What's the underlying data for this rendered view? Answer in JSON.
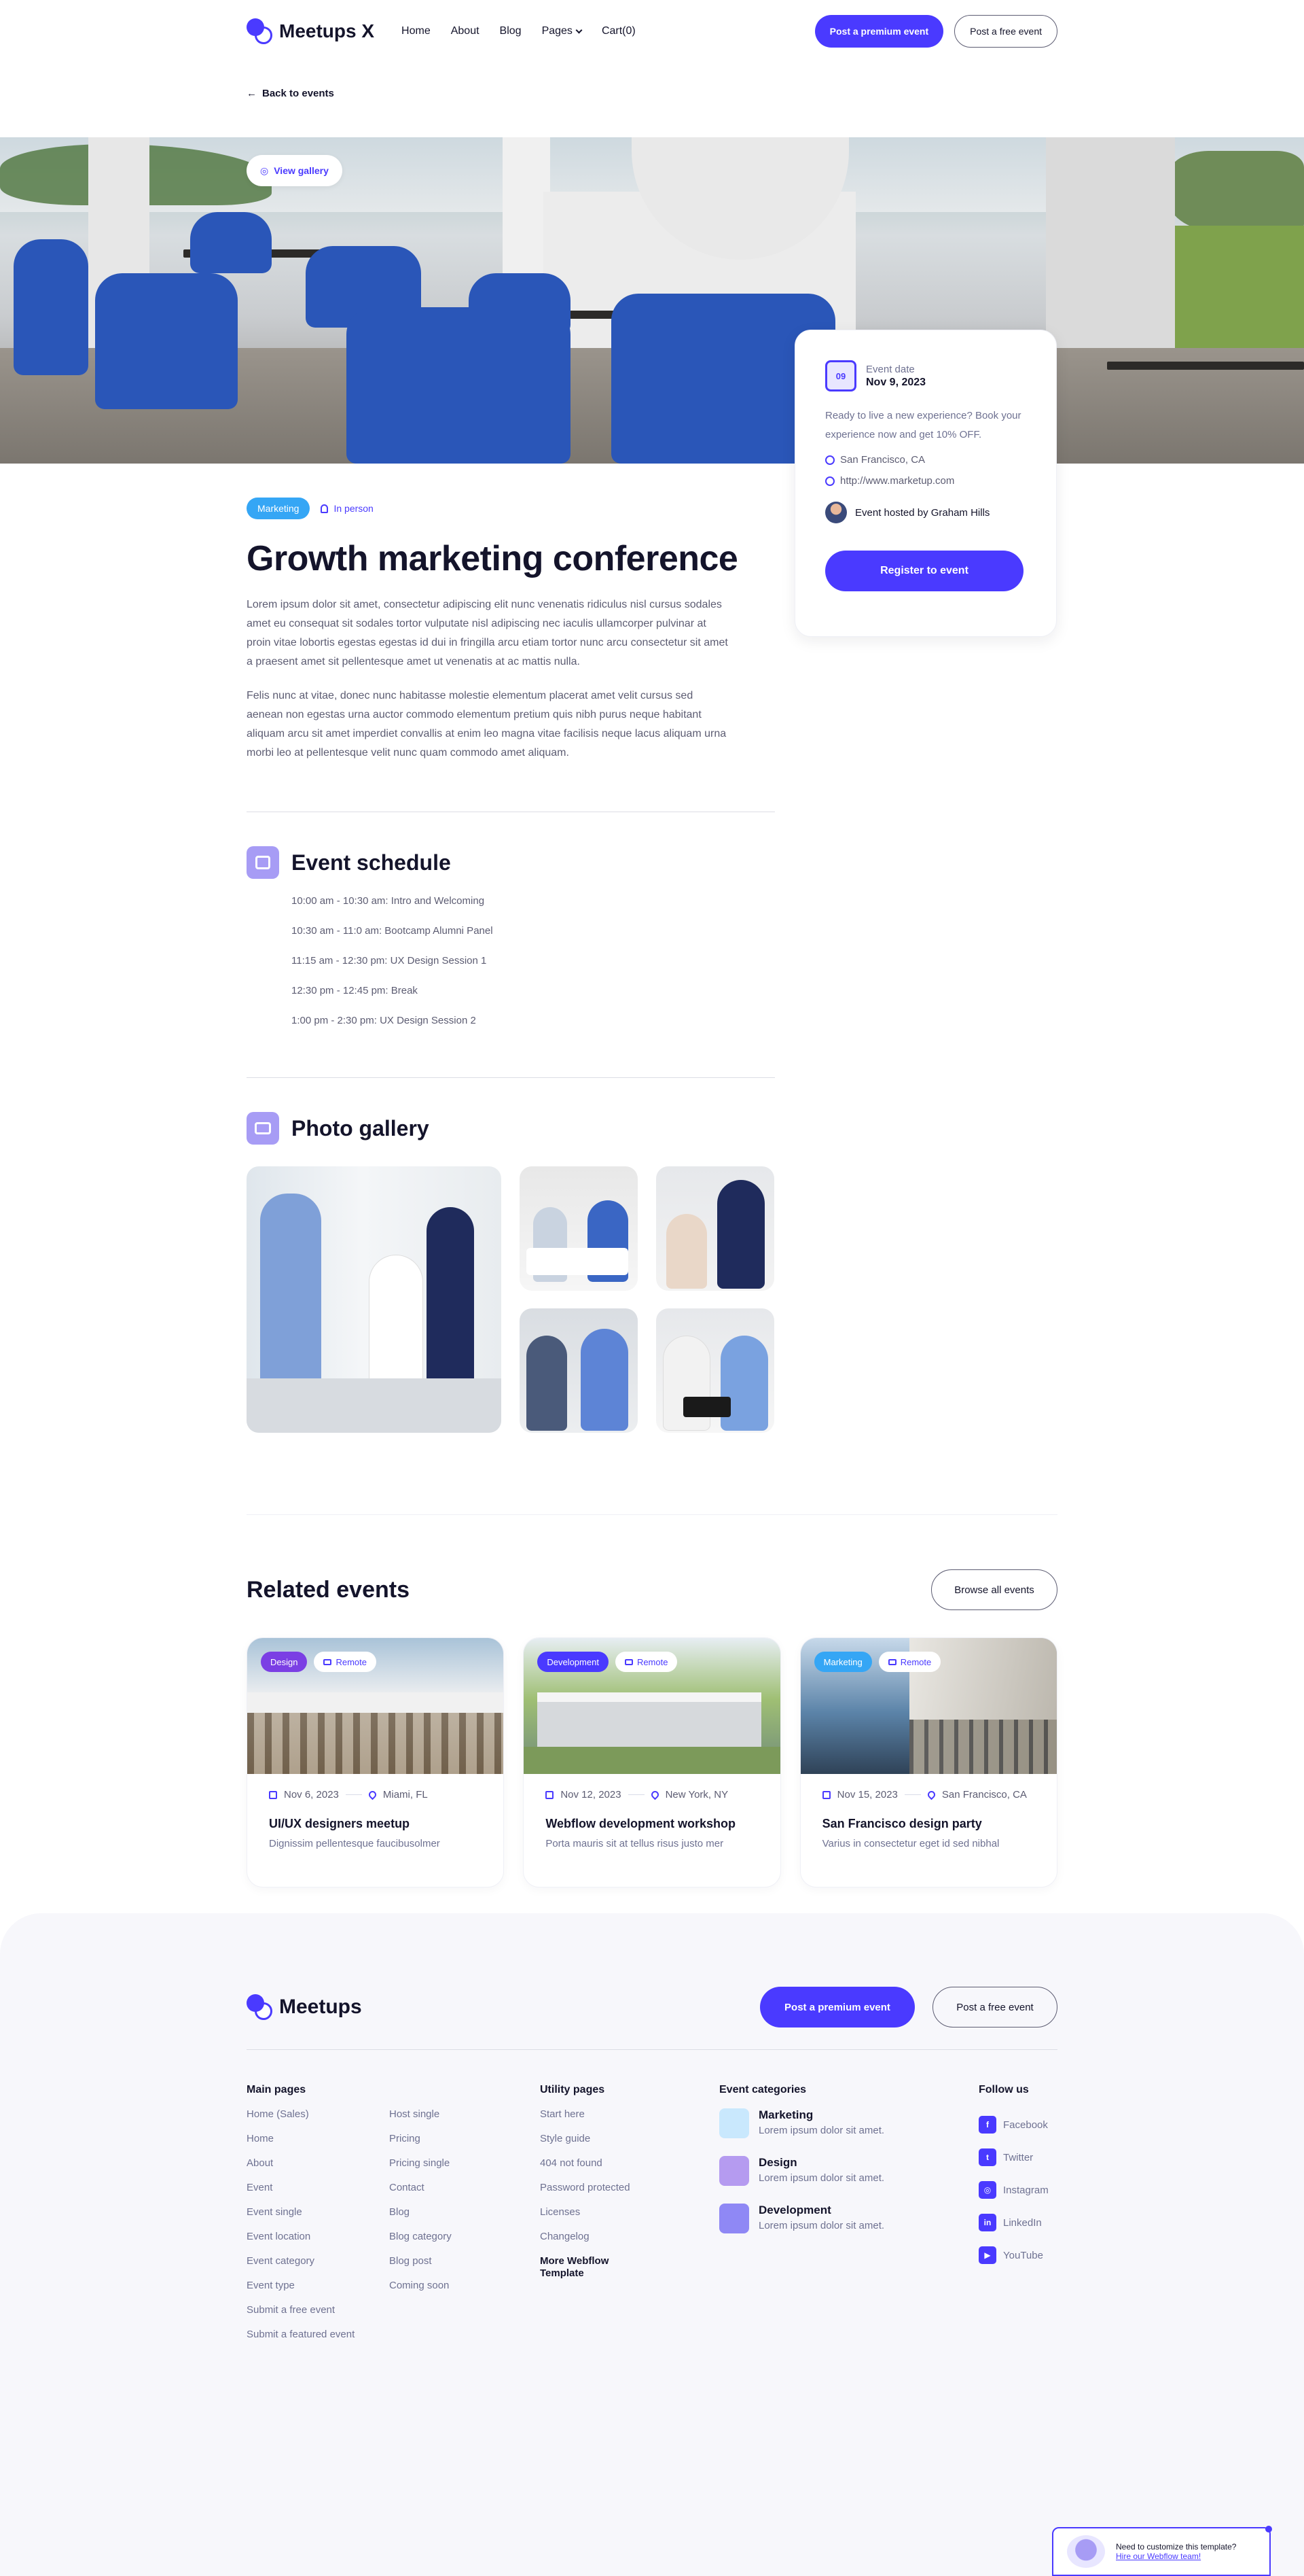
{
  "nav": {
    "brand": "Meetups X",
    "links": [
      "Home",
      "About",
      "Blog",
      "Pages",
      "Cart(0)"
    ],
    "premium_button": "Post a premium event",
    "free_button": "Post a free event"
  },
  "back_link": "Back to events",
  "hero": {
    "view_gallery": "View gallery"
  },
  "event_card": {
    "calendar_day": "09",
    "date_label": "Event date",
    "date_value": "Nov 9, 2023",
    "description": "Ready to live a new experience? Book your experience now and get 10% OFF.",
    "location": "San Francisco, CA",
    "website": "http://www.marketup.com",
    "host": "Event hosted by Graham Hills",
    "register_button": "Register to event"
  },
  "event": {
    "category_tag": "Marketing",
    "mode_tag": "In person",
    "title": "Growth marketing conference",
    "paragraph_1": "Lorem ipsum dolor sit amet, consectetur adipiscing elit nunc venenatis ridiculus nisl cursus sodales amet eu consequat sit sodales tortor vulputate nisl adipiscing nec iaculis ullamcorper pulvinar at proin vitae lobortis egestas egestas id dui in fringilla arcu etiam tortor nunc arcu consectetur sit amet a praesent amet sit pellentesque amet ut venenatis at ac mattis nulla.",
    "paragraph_2": "Felis nunc at vitae, donec nunc habitasse molestie elementum placerat amet velit cursus sed aenean non egestas urna auctor commodo elementum pretium quis nibh purus neque habitant aliquam arcu sit amet imperdiet convallis at enim leo magna vitae facilisis neque lacus aliquam urna morbi leo at pellentesque velit nunc quam commodo amet aliquam."
  },
  "schedule": {
    "title": "Event schedule",
    "items": [
      "10:00 am - 10:30 am:  Intro and Welcoming",
      "10:30 am - 11:0 am: Bootcamp Alumni Panel",
      "11:15 am - 12:30 pm: UX Design Session 1",
      "12:30 pm - 12:45 pm: Break",
      "1:00 pm - 2:30 pm: UX Design Session 2"
    ]
  },
  "gallery": {
    "title": "Photo gallery"
  },
  "related": {
    "title": "Related events",
    "browse_button": "Browse all events",
    "cards": [
      {
        "tag": "Design",
        "tag_color": "#7b3fe4",
        "mode": "Remote",
        "date": "Nov 6, 2023",
        "location": "Miami, FL",
        "title": "UI/UX designers meetup",
        "subtitle": "Dignissim pellentesque faucibusolmer"
      },
      {
        "tag": "Development",
        "tag_color": "#4a3aff",
        "mode": "Remote",
        "date": "Nov 12, 2023",
        "location": "New York, NY",
        "title": "Webflow development workshop",
        "subtitle": "Porta mauris sit at tellus risus justo mer"
      },
      {
        "tag": "Marketing",
        "tag_color": "#35a6f5",
        "mode": "Remote",
        "date": "Nov 15, 2023",
        "location": "San Francisco, CA",
        "title": "San Francisco design party",
        "subtitle": "Varius in consectetur eget id sed nibhal"
      }
    ]
  },
  "footer": {
    "brand": "Meetups",
    "premium_button": "Post a premium event",
    "free_button": "Post a free event",
    "main_pages_title": "Main pages",
    "main_pages_col1": [
      "Home (Sales)",
      "Home",
      "About",
      "Event",
      "Event single",
      "Event location",
      "Event category",
      "Event type",
      "Submit a free event",
      "Submit a featured event"
    ],
    "main_pages_col2": [
      "Host single",
      "Pricing",
      "Pricing single",
      "Contact",
      "Blog",
      "Blog category",
      "Blog post",
      "Coming soon"
    ],
    "utility_title": "Utility pages",
    "utility_pages": [
      "Start here",
      "Style guide",
      "404 not found",
      "Password protected",
      "Licenses",
      "Changelog"
    ],
    "more_templates": "More Webflow Template",
    "categories_title": "Event categories",
    "categories": [
      {
        "name": "Marketing",
        "desc": "Lorem ipsum dolor sit amet.",
        "color": "#c9e8fd"
      },
      {
        "name": "Design",
        "desc": "Lorem ipsum dolor sit amet.",
        "color": "#b59bf0"
      },
      {
        "name": "Development",
        "desc": "Lorem ipsum dolor sit amet.",
        "color": "#8f88f5"
      }
    ],
    "follow_title": "Follow us",
    "socials": [
      "Facebook",
      "Twitter",
      "Instagram",
      "LinkedIn",
      "YouTube"
    ]
  },
  "hire_widget": {
    "text": "Need to customize this template?",
    "link": "Hire our Webflow team!"
  },
  "colors": {
    "accent": "#4a3aff",
    "text": "#14142b",
    "muted": "#6e7191",
    "footer_bg": "#f7f7fb"
  }
}
